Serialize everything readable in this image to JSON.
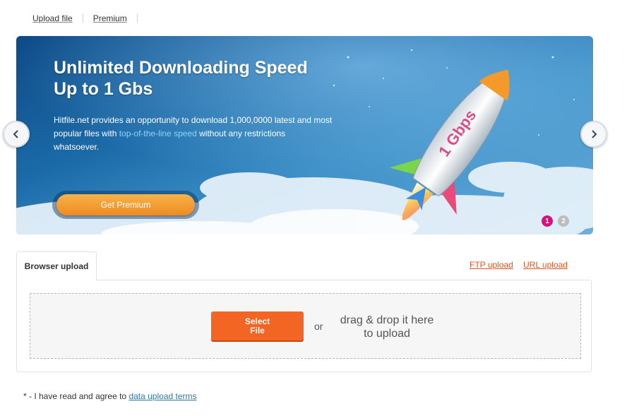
{
  "nav": {
    "upload_file": "Upload file",
    "premium": "Premium"
  },
  "banner": {
    "title_line1": "Unlimited Downloading Speed",
    "title_line2": "Up to 1 Gbs",
    "desc_before": "Hitfile.net provides an opportunity to download 1,000,0000 latest and most popular files with ",
    "desc_highlight": "top-of-the-line speed",
    "desc_after": " without any restrictions whatsoever.",
    "cta_label": "Get Premium",
    "rocket_label": "1 Gbps",
    "slides": [
      "1",
      "2"
    ],
    "active_slide": 1,
    "colors": {
      "cta": "#ef8b22",
      "active_dot": "#d4147a"
    }
  },
  "upload": {
    "tab_browser": "Browser upload",
    "tab_ftp": "FTP upload",
    "tab_url": "URL upload",
    "select_line1": "Select",
    "select_line2": "File",
    "or": "or",
    "drag_text": "drag & drop it here to upload",
    "colors": {
      "select_button": "#f26522",
      "links": "#e2531c"
    }
  },
  "terms": {
    "prefix": "* - I have read and agree to ",
    "link": "data upload terms"
  },
  "icons": {
    "prev": "chevron-left-icon",
    "next": "chevron-right-icon"
  }
}
